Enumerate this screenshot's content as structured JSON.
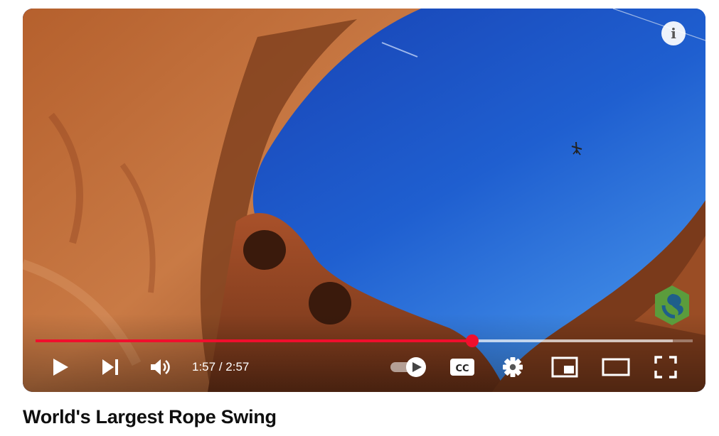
{
  "player": {
    "info_icon": "info-icon",
    "progress_fraction": 0.664,
    "buffer_fraction": 0.97,
    "time_current": "1:57",
    "time_total": "2:57",
    "accent_color": "#f00f2d",
    "controls": [
      "play-icon",
      "next-icon",
      "volume-icon",
      "autoplay-toggle-icon",
      "captions-icon",
      "settings-gear-icon",
      "miniplayer-icon",
      "theater-mode-icon",
      "fullscreen-icon"
    ]
  },
  "video": {
    "title": "World's Largest Rope Swing"
  }
}
